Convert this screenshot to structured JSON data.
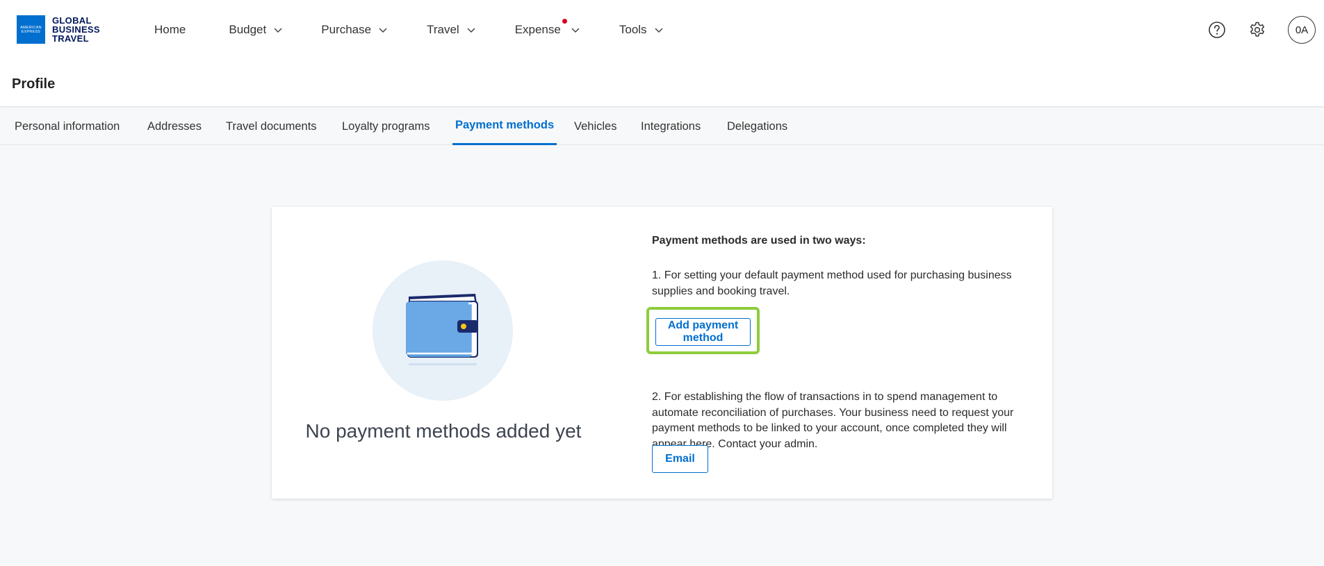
{
  "brand": {
    "logo_box_lines": [
      "AMERICAN",
      "EXPRESS"
    ],
    "logo_text_lines": [
      "GLOBAL",
      "BUSINESS",
      "TRAVEL"
    ]
  },
  "nav": {
    "items": [
      {
        "label": "Home",
        "has_dropdown": false,
        "has_notification": false
      },
      {
        "label": "Budget",
        "has_dropdown": true,
        "has_notification": false
      },
      {
        "label": "Purchase",
        "has_dropdown": true,
        "has_notification": false
      },
      {
        "label": "Travel",
        "has_dropdown": true,
        "has_notification": false
      },
      {
        "label": "Expense",
        "has_dropdown": true,
        "has_notification": true
      },
      {
        "label": "Tools",
        "has_dropdown": true,
        "has_notification": false
      }
    ],
    "icons": [
      "help-icon",
      "gear-icon"
    ],
    "avatar_initials": "0A"
  },
  "page": {
    "title": "Profile"
  },
  "tabs": [
    {
      "label": "Personal information",
      "active": false
    },
    {
      "label": "Addresses",
      "active": false
    },
    {
      "label": "Travel documents",
      "active": false
    },
    {
      "label": "Loyalty programs",
      "active": false
    },
    {
      "label": "Payment methods",
      "active": true
    },
    {
      "label": "Vehicles",
      "active": false
    },
    {
      "label": "Integrations",
      "active": false
    },
    {
      "label": "Delegations",
      "active": false
    }
  ],
  "empty_state": {
    "title": "No payment methods added yet",
    "illustration": "wallet-icon"
  },
  "info": {
    "heading": "Payment methods are used in two ways:",
    "point1": "1. For setting your default payment method used for purchasing business supplies and booking travel.",
    "add_button": "Add payment method",
    "point2": "2. For establishing the flow of transactions in to spend management to automate reconciliation of purchases. Your business need to request your payment methods to be linked to your account, once completed they will appear here. Contact your admin.",
    "email_button": "Email"
  },
  "colors": {
    "accent": "#006fcf",
    "brand_navy": "#00175a",
    "highlight": "#8dcc3c",
    "notification": "#d6001c"
  }
}
